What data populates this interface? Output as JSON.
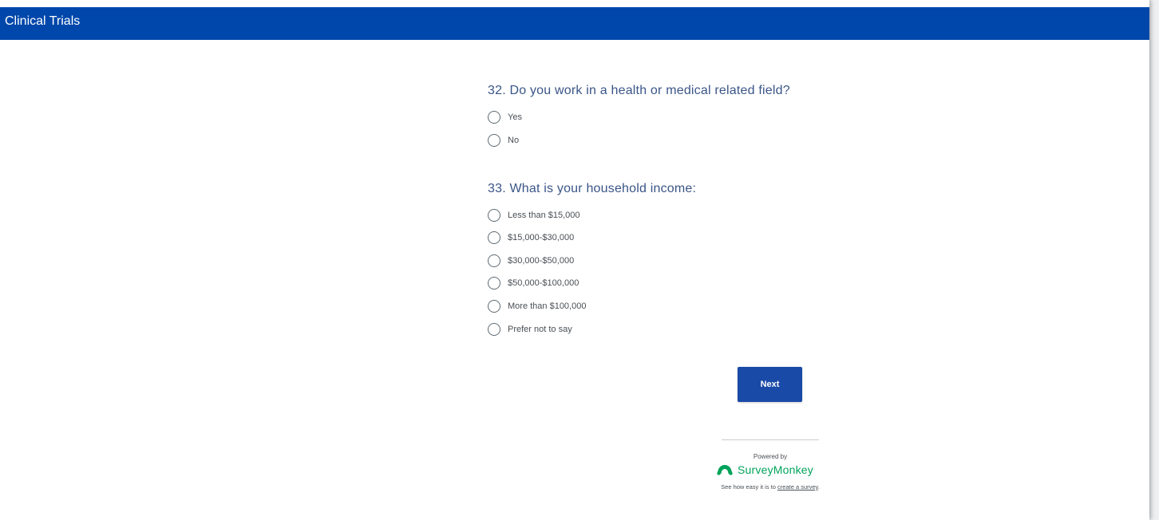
{
  "header": {
    "title": "Clinical Trials"
  },
  "questions": [
    {
      "title": "32. Do you work in a health or medical related field?",
      "options": [
        "Yes",
        "No"
      ]
    },
    {
      "title": "33. What is your household income:",
      "options": [
        "Less than $15,000",
        "$15,000-$30,000",
        "$30,000-$50,000",
        "$50,000-$100,000",
        "More than $100,000",
        "Prefer not to say"
      ]
    }
  ],
  "actions": {
    "next_label": "Next"
  },
  "footer": {
    "powered_by": "Powered by",
    "brand": "SurveyMonkey",
    "tagline_prefix": "See how easy it is to ",
    "tagline_link": "create a survey",
    "tagline_suffix": "."
  },
  "colors": {
    "header_bg": "#0047ab",
    "question_text": "#3a5587",
    "button_bg": "#1a4aa8",
    "brand_green": "#00a35a"
  },
  "icons": {
    "logo": "surveymonkey-logo-icon",
    "radio": "radio-button-icon"
  }
}
